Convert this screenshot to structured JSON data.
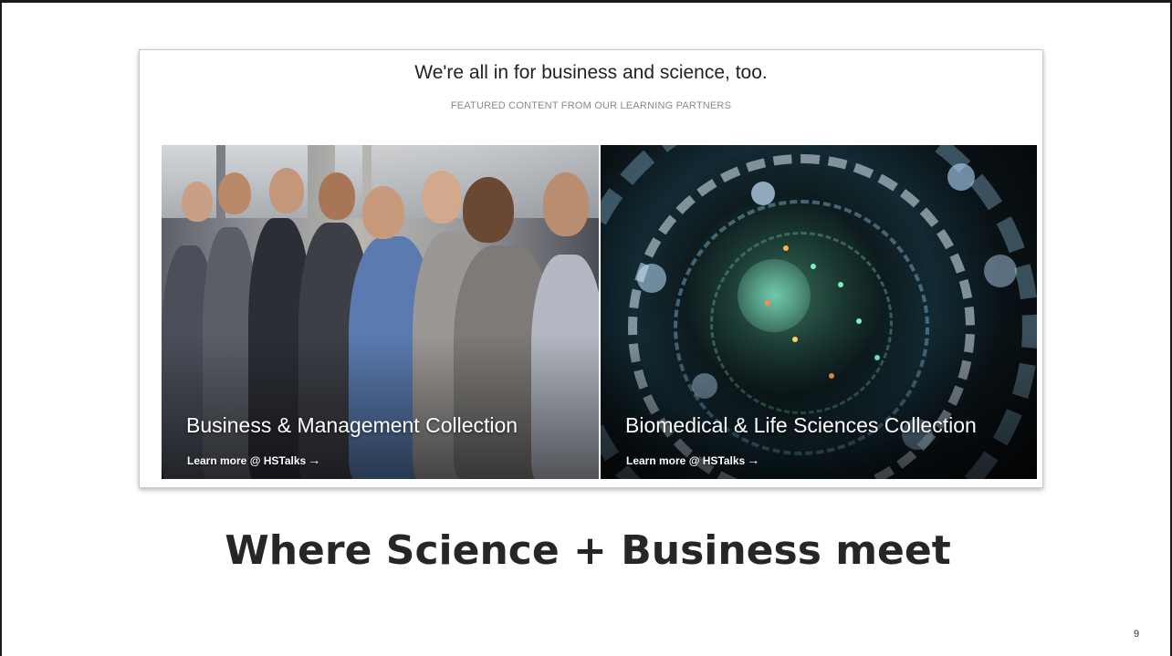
{
  "panel": {
    "title": "We're all in for business and science, too.",
    "subtitle": "FEATURED CONTENT FROM OUR LEARNING PARTNERS",
    "cards": [
      {
        "title": "Business & Management Collection",
        "link_text": "Learn more @ HSTalks",
        "link_icon": "→",
        "image": "business-audience-photo"
      },
      {
        "title": "Biomedical & Life Sciences Collection",
        "link_text": "Learn more @ HSTalks",
        "link_icon": "→",
        "image": "biomedical-lens-photo"
      }
    ]
  },
  "headline": "Where Science + Business meet",
  "page_number": "9",
  "colors": {
    "headline": "#262626",
    "panel_title": "#222222",
    "subtitle": "#8a8a8a",
    "card_text": "#ffffff"
  }
}
